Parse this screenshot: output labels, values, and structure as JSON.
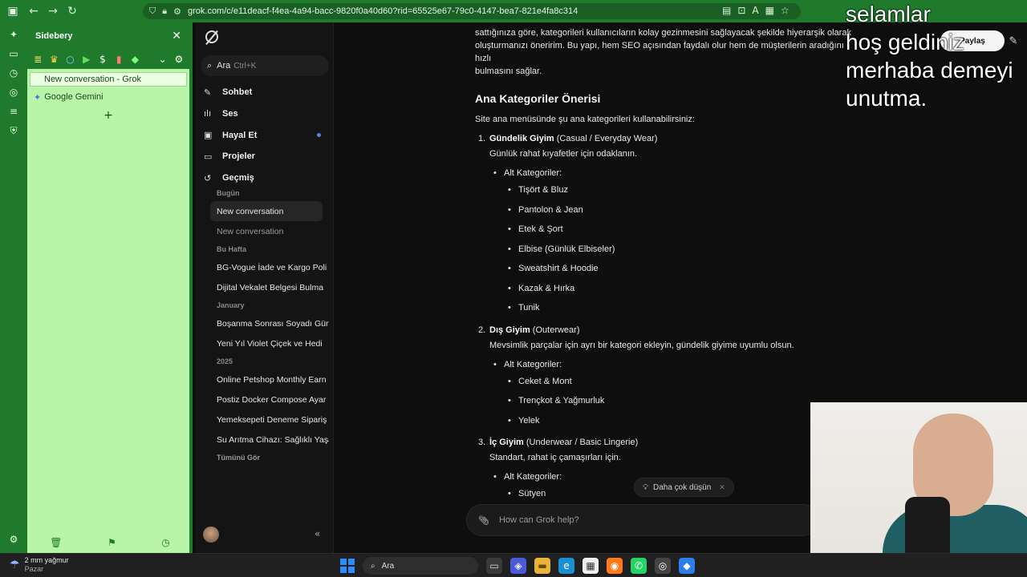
{
  "browser": {
    "url": "grok.com/c/e11deacf-f4ea-4a94-bacc-9820f0a40d60?rid=65525e67-79c0-4147-bea7-821e4fa8c314"
  },
  "sidebery": {
    "title": "Sidebery",
    "items": [
      {
        "label": "New conversation - Grok"
      },
      {
        "label": "Google Gemini"
      }
    ]
  },
  "grok": {
    "search": {
      "label": "Ara",
      "shortcut": "Ctrl+K"
    },
    "nav": [
      {
        "label": "Sohbet",
        "icon": "chat-icon"
      },
      {
        "label": "Ses",
        "icon": "audio-icon"
      },
      {
        "label": "Hayal Et",
        "icon": "image-icon"
      },
      {
        "label": "Projeler",
        "icon": "folder-icon"
      },
      {
        "label": "Geçmiş",
        "icon": "history-icon"
      }
    ],
    "history": {
      "today": "Bugün",
      "today_items": [
        "New conversation",
        "New conversation"
      ],
      "week": "Bu Hafta",
      "week_items": [
        "BG-Vogue İade ve Kargo Poli",
        "Dijital Vekalet Belgesi Bulma"
      ],
      "january": "January",
      "january_items": [
        "Boşanma Sonrası Soyadı Gün",
        "Yeni Yıl Violet Çiçek ve Hedi"
      ],
      "year": "2025",
      "year_items": [
        "Online Petshop Monthly Earn",
        "Postiz Docker Compose Ayar",
        "Yemeksepeti Deneme Sipariş",
        "Su Arıtma Cihazı: Sağlıklı Yaşa"
      ],
      "see_all": "Tümünü Gör"
    }
  },
  "content": {
    "intro_1": "sattığınıza göre, kategorileri kullanıcıların kolay gezinmesini sağlayacak şekilde hiyerarşik olarak",
    "intro_2": "oluşturmanızı öneririm. Bu yapı, hem SEO açısından faydalı olur hem de müşterilerin aradığını hızlı",
    "intro_3": "bulmasını sağlar.",
    "heading": "Ana Kategoriler Önerisi",
    "lead": "Site ana menüsünde şu ana kategorileri kullanabilirsiniz:",
    "alt_label": "Alt Kategoriler:",
    "categories": [
      {
        "num": "1.",
        "bold": "Gündelik Giyim",
        "rest": " (Casual / Everyday Wear)",
        "desc": "Günlük rahat kıyafetler için odaklanın.",
        "subs": [
          "Tişört & Bluz",
          "Pantolon & Jean",
          "Etek & Şort",
          "Elbise (Günlük Elbiseler)",
          "Sweatshirt & Hoodie",
          "Kazak & Hırka",
          "Tunik"
        ]
      },
      {
        "num": "2.",
        "bold": "Dış Giyim",
        "rest": " (Outerwear)",
        "desc": "Mevsimlik parçalar için ayrı bir kategori ekleyin, gündelik giyime uyumlu olsun.",
        "subs": [
          "Ceket & Mont",
          "Trençkot & Yağmurluk",
          "Yelek"
        ]
      },
      {
        "num": "3.",
        "bold": "İç Giyim",
        "rest": " (Underwear / Basic Lingerie)",
        "desc": "Standart, rahat iç çamaşırları için.",
        "subs": [
          "Sütyen"
        ]
      }
    ],
    "suggestion_pill": "Daha çok düşün",
    "composer_placeholder": "How can Grok help?",
    "share_label": "Paylaş"
  },
  "overlay_text": "selamlar\nhoş geldiniz\nmerhaba demeyi\nunutma.",
  "taskbar": {
    "weather_temp": "2 mm yağmur",
    "weather_day": "Pazar",
    "search_label": "Ara"
  },
  "colors": {
    "sidebery_bg": "#b9f5a8",
    "browser_green": "#1f7a2b",
    "grok_bg": "#0e0e0e"
  }
}
